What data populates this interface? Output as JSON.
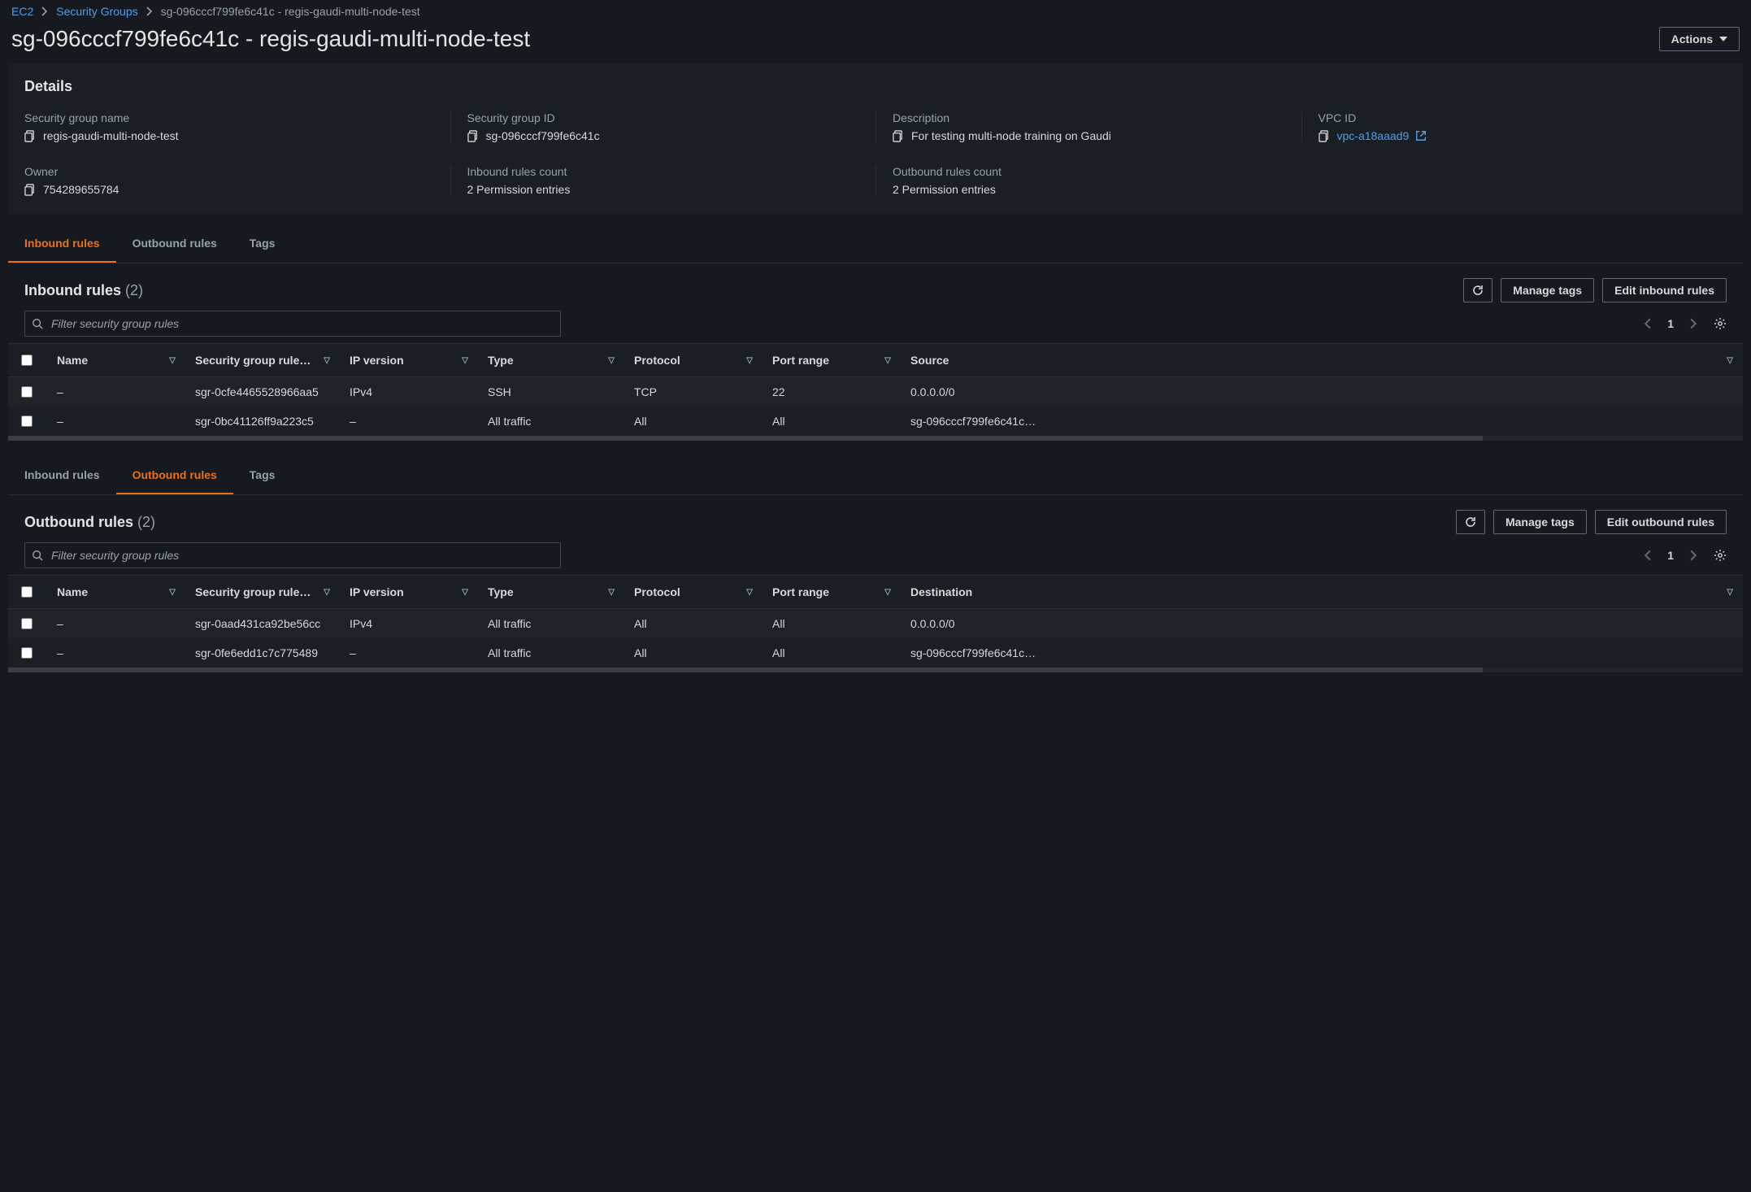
{
  "breadcrumb": {
    "root": "EC2",
    "section": "Security Groups",
    "current": "sg-096cccf799fe6c41c - regis-gaudi-multi-node-test"
  },
  "page": {
    "title": "sg-096cccf799fe6c41c - regis-gaudi-multi-node-test",
    "actions_label": "Actions"
  },
  "details": {
    "heading": "Details",
    "fields": {
      "sg_name": {
        "label": "Security group name",
        "value": "regis-gaudi-multi-node-test"
      },
      "sg_id": {
        "label": "Security group ID",
        "value": "sg-096cccf799fe6c41c"
      },
      "desc": {
        "label": "Description",
        "value": "For testing multi-node training on Gaudi"
      },
      "vpc": {
        "label": "VPC ID",
        "value": "vpc-a18aaad9"
      },
      "owner": {
        "label": "Owner",
        "value": "754289655784"
      },
      "in_cnt": {
        "label": "Inbound rules count",
        "value": "2 Permission entries"
      },
      "out_cnt": {
        "label": "Outbound rules count",
        "value": "2 Permission entries"
      }
    }
  },
  "tabs1": {
    "inbound": "Inbound rules",
    "outbound": "Outbound rules",
    "tags": "Tags"
  },
  "tabs2": {
    "inbound": "Inbound rules",
    "outbound": "Outbound rules",
    "tags": "Tags"
  },
  "inbound": {
    "title": "Inbound rules",
    "count": "(2)",
    "manage_tags": "Manage tags",
    "edit": "Edit inbound rules",
    "filter_placeholder": "Filter security group rules",
    "page": "1",
    "columns": {
      "name": "Name",
      "rule": "Security group rule…",
      "ipv": "IP version",
      "type": "Type",
      "proto": "Protocol",
      "port": "Port range",
      "src": "Source"
    },
    "rows": [
      {
        "name": "–",
        "rule": "sgr-0cfe4465528966aa5",
        "ipv": "IPv4",
        "type": "SSH",
        "proto": "TCP",
        "port": "22",
        "src": "0.0.0.0/0"
      },
      {
        "name": "–",
        "rule": "sgr-0bc41126ff9a223c5",
        "ipv": "–",
        "type": "All traffic",
        "proto": "All",
        "port": "All",
        "src": "sg-096cccf799fe6c41c…"
      }
    ]
  },
  "outbound": {
    "title": "Outbound rules",
    "count": "(2)",
    "manage_tags": "Manage tags",
    "edit": "Edit outbound rules",
    "filter_placeholder": "Filter security group rules",
    "page": "1",
    "columns": {
      "name": "Name",
      "rule": "Security group rule…",
      "ipv": "IP version",
      "type": "Type",
      "proto": "Protocol",
      "port": "Port range",
      "dst": "Destination"
    },
    "rows": [
      {
        "name": "–",
        "rule": "sgr-0aad431ca92be56cc",
        "ipv": "IPv4",
        "type": "All traffic",
        "proto": "All",
        "port": "All",
        "dst": "0.0.0.0/0"
      },
      {
        "name": "–",
        "rule": "sgr-0fe6edd1c7c775489",
        "ipv": "–",
        "type": "All traffic",
        "proto": "All",
        "port": "All",
        "dst": "sg-096cccf799fe6c41c…"
      }
    ]
  }
}
